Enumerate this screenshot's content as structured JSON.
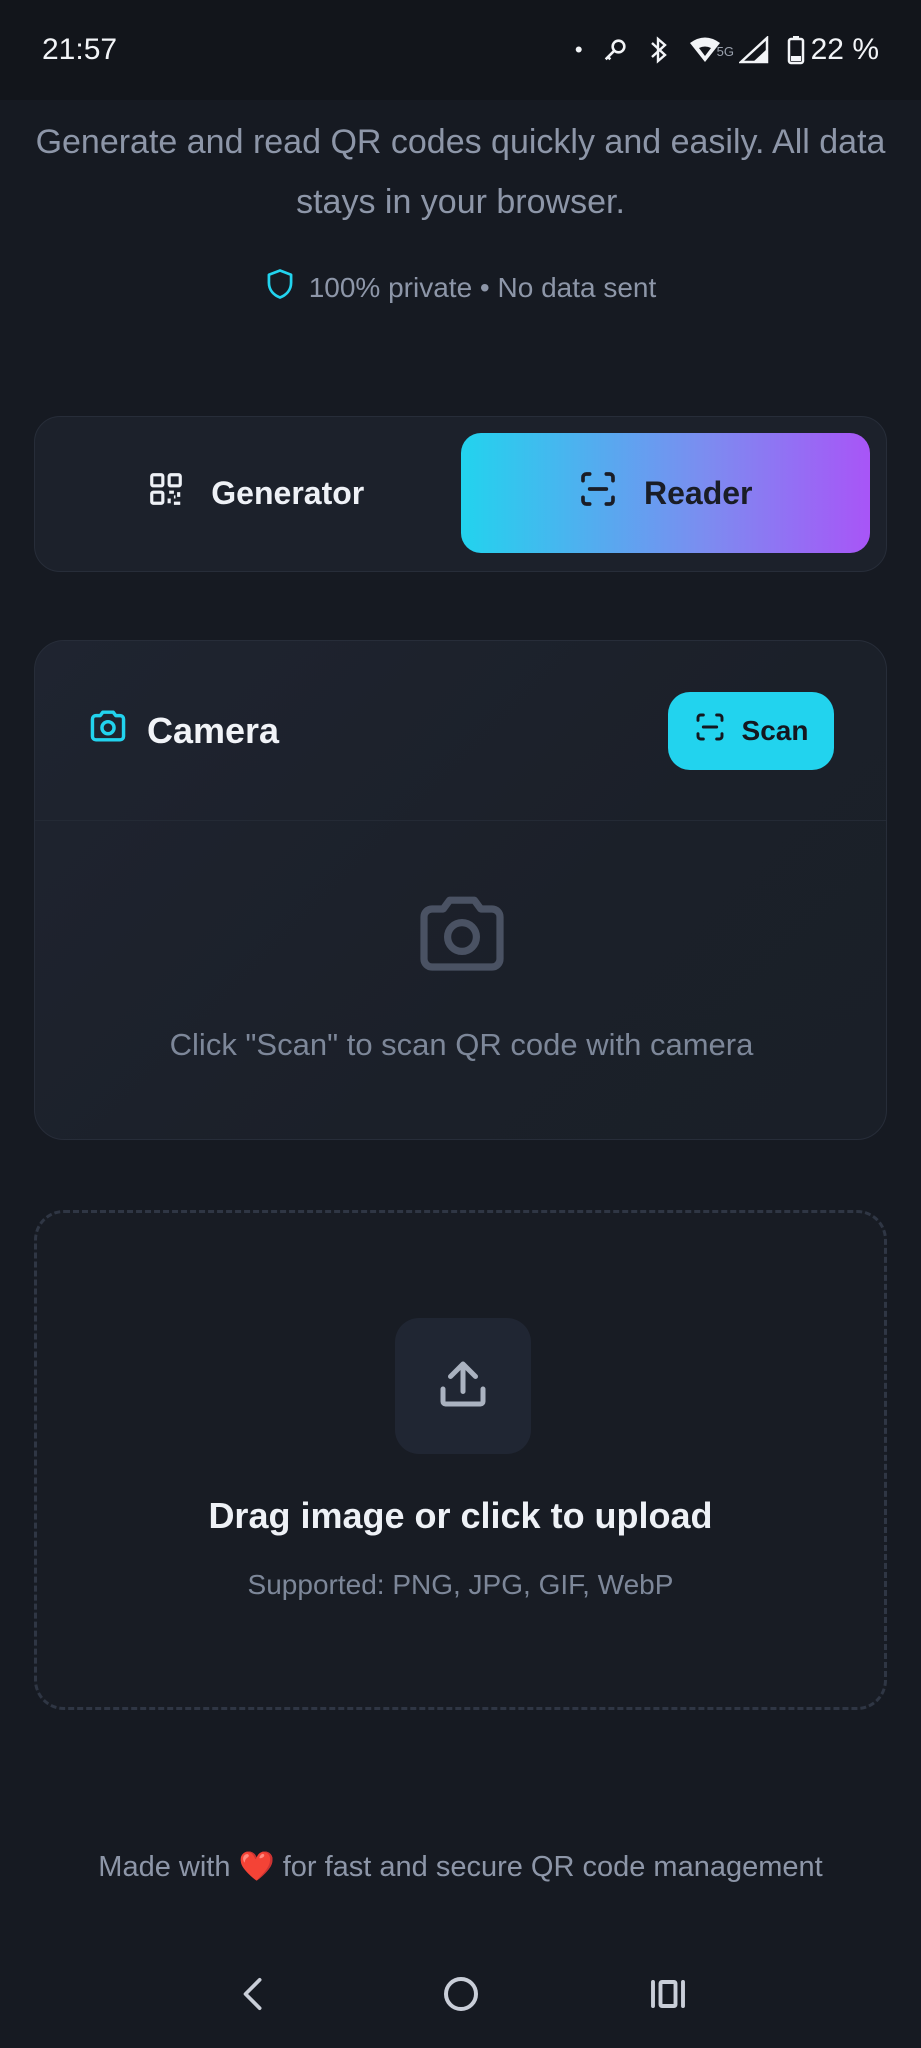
{
  "status_bar": {
    "time": "21:57",
    "dot": "•",
    "network": "5G",
    "battery": "22 %"
  },
  "intro": {
    "description": "Generate and read QR codes quickly and easily. All data stays in your browser.",
    "privacy": "100% private • No data sent"
  },
  "tabs": [
    {
      "label": "Generator",
      "icon": "qr-code-icon",
      "active": false
    },
    {
      "label": "Reader",
      "icon": "scan-icon",
      "active": true
    }
  ],
  "camera": {
    "title": "Camera",
    "scan_label": "Scan",
    "hint": "Click \"Scan\" to scan QR code with camera"
  },
  "upload": {
    "title": "Drag image or click to upload",
    "supported": "Supported: PNG, JPG, GIF, WebP"
  },
  "footer": {
    "before": "Made with",
    "heart": "❤️",
    "after": "for fast and secure QR code management"
  },
  "colors": {
    "background": "#161a22",
    "accent": "#22d3ee",
    "gradient_end": "#a855f7",
    "muted_text": "#8d96a8"
  }
}
